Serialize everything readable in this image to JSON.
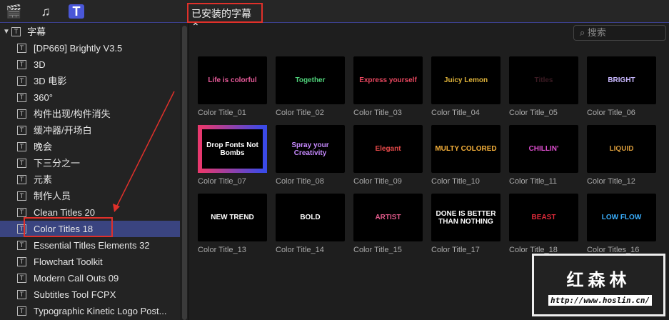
{
  "toolbar": {
    "icons": [
      "clapper-star-icon",
      "music-photo-icon",
      "titles-icon"
    ],
    "installed_label": "已安装的字幕 ⌃",
    "search_placeholder": "搜索"
  },
  "sidebar": {
    "root": "字幕",
    "items": [
      "[DP669] Brightly V3.5",
      "3D",
      "3D 电影",
      "360°",
      "构件出现/构件消失",
      "缓冲器/开场白",
      "晚会",
      "下三分之一",
      "元素",
      "制作人员",
      "Clean Titles 20",
      "Color Titles 18",
      "Essential Titles Elements 32",
      "Flowchart Toolkit",
      "Modern Call Outs 09",
      "Subtitles Tool FCPX",
      "Typographic Kinetic Logo Post..."
    ],
    "selected_index": 11
  },
  "grid": [
    {
      "name": "Color Title_01",
      "preview": "Life is colorful",
      "color": "#e85a9a"
    },
    {
      "name": "Color Title_02",
      "preview": "Together",
      "color": "#4fd27a"
    },
    {
      "name": "Color Title_03",
      "preview": "Express yourself",
      "color": "#e8475f"
    },
    {
      "name": "Color Title_04",
      "preview": "Juicy Lemon",
      "color": "#e0b43a"
    },
    {
      "name": "Color Title_05",
      "preview": "Titles",
      "color": "#3a1a22"
    },
    {
      "name": "Color Title_06",
      "preview": "BRIGHT",
      "color": "#c9b8ff"
    },
    {
      "name": "Color Title_07",
      "preview": "Drop Fonts Not Bombs",
      "color": "#ffffff"
    },
    {
      "name": "Color Title_08",
      "preview": "Spray your Creativity",
      "color": "#c78aff"
    },
    {
      "name": "Color Title_09",
      "preview": "Elegant",
      "color": "#e84a4a"
    },
    {
      "name": "Color Title_10",
      "preview": "MULTY COLORED",
      "color": "#f5b03a"
    },
    {
      "name": "Color Title_11",
      "preview": "CHILLIN'",
      "color": "#e04fd0"
    },
    {
      "name": "Color Title_12",
      "preview": "LIQUID",
      "color": "#d79a3a"
    },
    {
      "name": "Color Title_13",
      "preview": "NEW TREND",
      "color": "#ffffff"
    },
    {
      "name": "Color Title_14",
      "preview": "BOLD",
      "color": "#ffffff"
    },
    {
      "name": "Color Title_15",
      "preview": "ARTIST",
      "color": "#e05a8a"
    },
    {
      "name": "Color Title_17",
      "preview": "DONE IS BETTER THAN NOTHING",
      "color": "#ffffff"
    },
    {
      "name": "Color Title_18",
      "preview": "BEAST",
      "color": "#e02a3a"
    },
    {
      "name": "Color Titles_16",
      "preview": "LOW FLOW",
      "color": "#3ab0ff"
    }
  ],
  "watermark": {
    "title": "红森林",
    "url": "http://www.hoslin.cn/"
  }
}
